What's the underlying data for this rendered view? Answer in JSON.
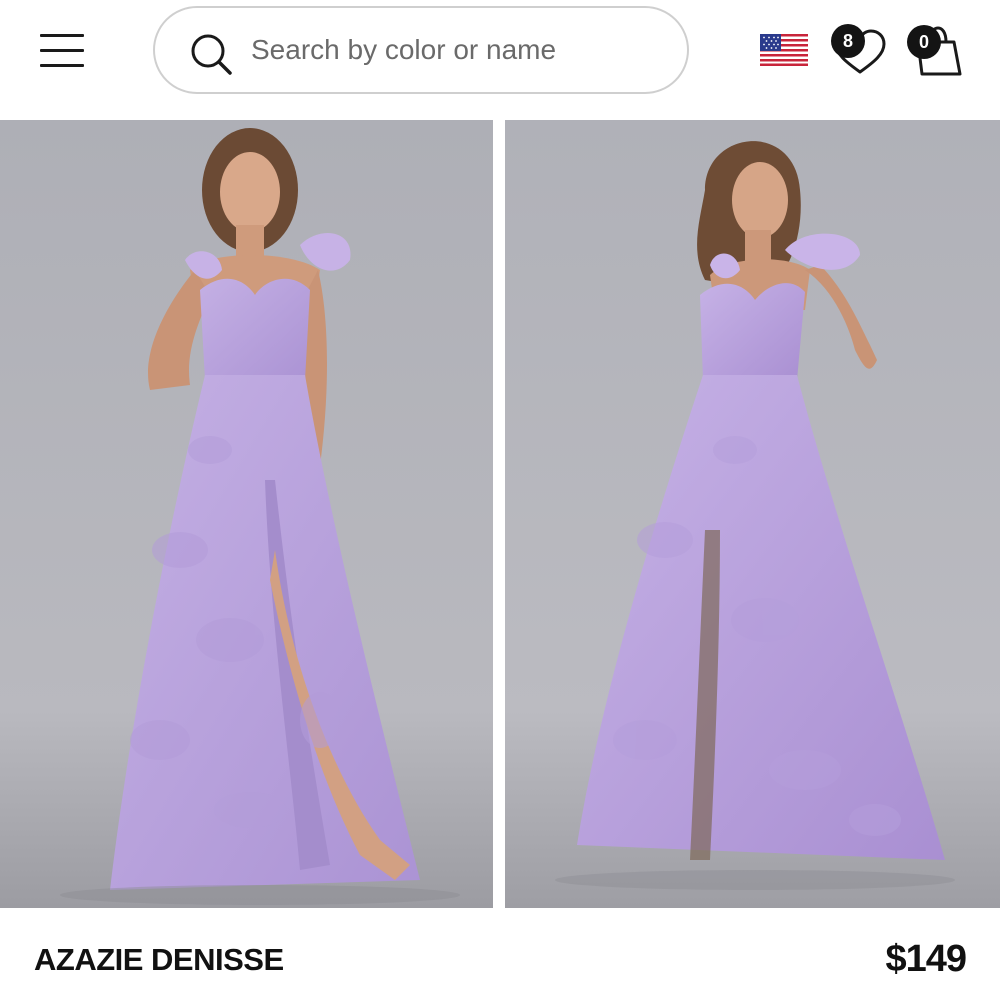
{
  "search": {
    "placeholder": "Search by color or name"
  },
  "header": {
    "wishlist_count": "8",
    "cart_count": "0"
  },
  "product": {
    "name": "AZAZIE DENISSE",
    "price": "$149"
  },
  "colors": {
    "dress": "#b9a3dc",
    "backdrop": "#b6b7bd",
    "badge": "#141414"
  },
  "icons": [
    "menu-icon",
    "search-icon",
    "us-flag-icon",
    "heart-icon",
    "shopping-bag-icon"
  ]
}
